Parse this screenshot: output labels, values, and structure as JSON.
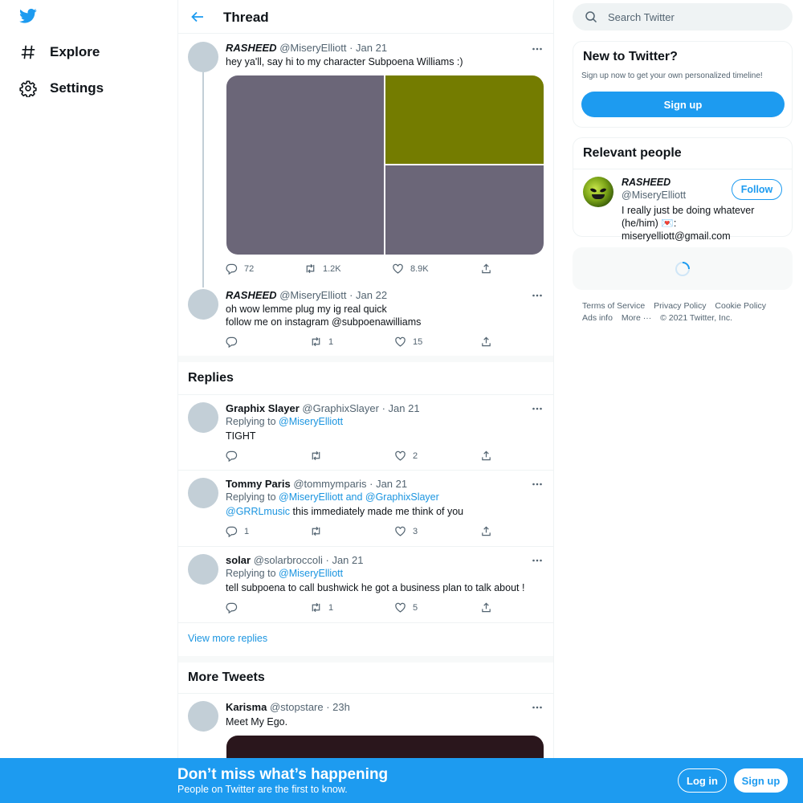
{
  "nav": {
    "items": [
      {
        "label": "Explore",
        "icon": "hashtag-icon"
      },
      {
        "label": "Settings",
        "icon": "gear-icon"
      }
    ]
  },
  "header": {
    "title": "Thread"
  },
  "thread": [
    {
      "name": "RASHEED",
      "handle": "@MiseryElliott",
      "date": "· Jan 21",
      "text": "hey ya'll, say hi to my character Subpoena Williams :)",
      "media_colors": [
        "#6b6678",
        "#747c00",
        "#6b6678"
      ],
      "replies": "72",
      "retweets": "1.2K",
      "likes": "8.9K"
    },
    {
      "name": "RASHEED",
      "handle": "@MiseryElliott",
      "date": "· Jan 22",
      "text_line1": "oh wow lemme plug my ig real quick",
      "text_line2": "follow me on instagram @subpoenawilliams",
      "replies": "",
      "retweets": "1",
      "likes": "15"
    }
  ],
  "replies_section": {
    "title": "Replies",
    "view_more": "View more replies",
    "items": [
      {
        "name": "Graphix Slayer",
        "handle": "@GraphixSlayer",
        "date": "· Jan 21",
        "replying_label": "Replying to",
        "replying_to": "@MiseryElliott",
        "text": "TIGHT",
        "replies": "",
        "retweets": "",
        "likes": "2"
      },
      {
        "name": "Tommy Paris",
        "handle": "@tommymparis",
        "date": "· Jan 21",
        "replying_label": "Replying to",
        "replying_to": "@MiseryElliott and @GraphixSlayer",
        "mention": "@GRRLmusic",
        "text": " this immediately made me think of you",
        "replies": "1",
        "retweets": "",
        "likes": "3"
      },
      {
        "name": "solar",
        "handle": "@solarbroccoli",
        "date": "· Jan 21",
        "replying_label": "Replying to",
        "replying_to": "@MiseryElliott",
        "text": "tell subpoena to call bushwick he got a business plan to talk about !",
        "replies": "",
        "retweets": "1",
        "likes": "5"
      }
    ]
  },
  "more_tweets": {
    "title": "More Tweets",
    "items": [
      {
        "name": "Karisma",
        "handle": "@stopstare",
        "date": "· 23h",
        "text": "Meet My Ego.",
        "media_color": "#2a161c"
      }
    ]
  },
  "search": {
    "placeholder": "Search Twitter"
  },
  "new_to_twitter": {
    "title": "New to Twitter?",
    "subtitle": "Sign up now to get your own personalized timeline!",
    "button": "Sign up"
  },
  "relevant_people": {
    "title": "Relevant people",
    "name": "RASHEED",
    "handle": "@MiseryElliott",
    "follow": "Follow",
    "bio": "I really just be doing whatever (he/him) 💌: miseryelliott@gmail.com"
  },
  "footer": {
    "terms": "Terms of Service",
    "privacy": "Privacy Policy",
    "cookie": "Cookie Policy",
    "ads": "Ads info",
    "more": "More ···",
    "copyright": "© 2021 Twitter, Inc."
  },
  "banner": {
    "title": "Don’t miss what’s happening",
    "subtitle": "People on Twitter are the first to know.",
    "login": "Log in",
    "signup": "Sign up"
  },
  "colors": {
    "accent": "#1d9bf0",
    "link": "#1b95e0",
    "avatar_placeholder": "#c3cfd7"
  }
}
